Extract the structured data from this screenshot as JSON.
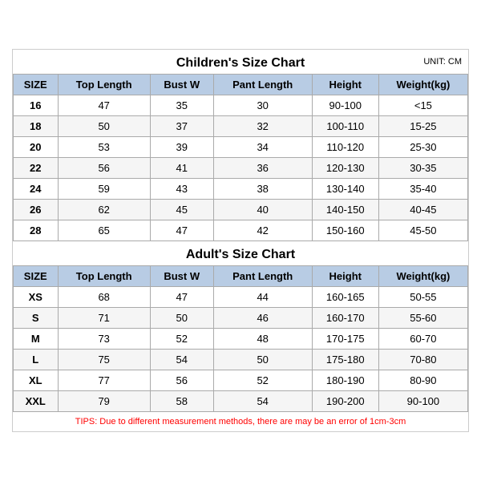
{
  "children_title": "Children's Size Chart",
  "adult_title": "Adult's Size Chart",
  "unit": "UNIT: CM",
  "tips": "TIPS: Due to different measurement methods, there are may be an error of 1cm-3cm",
  "columns": [
    "SIZE",
    "Top Length",
    "Bust W",
    "Pant Length",
    "Height",
    "Weight(kg)"
  ],
  "children_rows": [
    [
      "16",
      "47",
      "35",
      "30",
      "90-100",
      "<15"
    ],
    [
      "18",
      "50",
      "37",
      "32",
      "100-110",
      "15-25"
    ],
    [
      "20",
      "53",
      "39",
      "34",
      "110-120",
      "25-30"
    ],
    [
      "22",
      "56",
      "41",
      "36",
      "120-130",
      "30-35"
    ],
    [
      "24",
      "59",
      "43",
      "38",
      "130-140",
      "35-40"
    ],
    [
      "26",
      "62",
      "45",
      "40",
      "140-150",
      "40-45"
    ],
    [
      "28",
      "65",
      "47",
      "42",
      "150-160",
      "45-50"
    ]
  ],
  "adult_rows": [
    [
      "XS",
      "68",
      "47",
      "44",
      "160-165",
      "50-55"
    ],
    [
      "S",
      "71",
      "50",
      "46",
      "160-170",
      "55-60"
    ],
    [
      "M",
      "73",
      "52",
      "48",
      "170-175",
      "60-70"
    ],
    [
      "L",
      "75",
      "54",
      "50",
      "175-180",
      "70-80"
    ],
    [
      "XL",
      "77",
      "56",
      "52",
      "180-190",
      "80-90"
    ],
    [
      "XXL",
      "79",
      "58",
      "54",
      "190-200",
      "90-100"
    ]
  ]
}
